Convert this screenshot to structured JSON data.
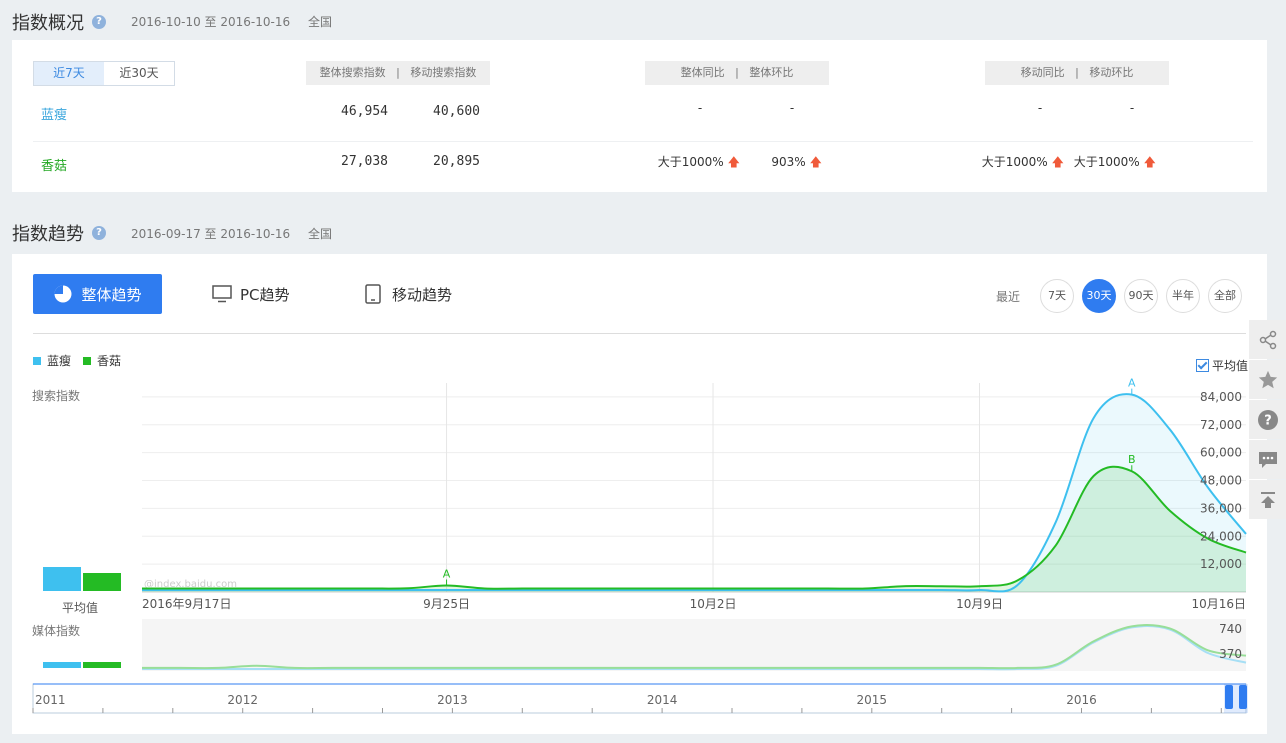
{
  "overview": {
    "title": "指数概况",
    "date_range": "2016-10-10 至 2016-10-16",
    "region": "全国",
    "tabs": [
      "近7天",
      "近30天"
    ],
    "header_total": "整体搜索指数",
    "header_mobile": "移动搜索指数",
    "header_yoy": "整体同比",
    "header_mom": "整体环比",
    "header_m_yoy": "移动同比",
    "header_m_mom": "移动环比",
    "sep": "|",
    "rows": [
      {
        "keyword": "蓝瘦",
        "total": "46,954",
        "mobile": "40,600",
        "yoy": "-",
        "mom": "-",
        "m_yoy": "-",
        "m_mom": "-"
      },
      {
        "keyword": "香菇",
        "total": "27,038",
        "mobile": "20,895",
        "yoy": "大于1000%",
        "mom": "903%",
        "m_yoy": "大于1000%",
        "m_mom": "大于1000%"
      }
    ]
  },
  "trend": {
    "title": "指数趋势",
    "date_range": "2016-09-17 至 2016-10-16",
    "region": "全国",
    "btn_overall": "整体趋势",
    "btn_pc": "PC趋势",
    "btn_mobile": "移动趋势",
    "recent_label": "最近",
    "ranges": [
      "7天",
      "30天",
      "90天",
      "半年",
      "全部"
    ],
    "avg_label": "平均值",
    "search_label": "搜索指数",
    "media_label": "媒体指数",
    "avg_bar_label": "平均值",
    "watermark": "@index.baidu.com",
    "marker_a": "A",
    "marker_b": "B"
  },
  "colors": {
    "lanshou": "#3ec0ef",
    "xianggu": "#24bb24",
    "accent": "#2f7cf0"
  },
  "chart_data": {
    "type": "area",
    "x": [
      "2016-09-17",
      "2016-09-18",
      "2016-09-19",
      "2016-09-20",
      "2016-09-21",
      "2016-09-22",
      "2016-09-23",
      "2016-09-24",
      "2016-09-25",
      "2016-09-26",
      "2016-09-27",
      "2016-09-28",
      "2016-09-29",
      "2016-09-30",
      "2016-10-01",
      "2016-10-02",
      "2016-10-03",
      "2016-10-04",
      "2016-10-05",
      "2016-10-06",
      "2016-10-07",
      "2016-10-08",
      "2016-10-09",
      "2016-10-10",
      "2016-10-11",
      "2016-10-12",
      "2016-10-13",
      "2016-10-14",
      "2016-10-15",
      "2016-10-16"
    ],
    "xticks": [
      "2016年9月17日",
      "9月25日",
      "10月2日",
      "10月9日",
      "10月16日"
    ],
    "series": [
      {
        "name": "蓝瘦",
        "values": [
          0,
          0,
          0,
          0,
          0,
          0,
          0,
          0,
          0,
          0,
          0,
          0,
          0,
          0,
          0,
          0,
          0,
          0,
          0,
          0,
          0,
          0,
          0,
          3000,
          30000,
          75000,
          85000,
          70000,
          45000,
          25000
        ]
      },
      {
        "name": "香菇",
        "values": [
          1500,
          1500,
          1500,
          1500,
          1500,
          1500,
          1500,
          1600,
          2800,
          1500,
          1500,
          1500,
          1500,
          1500,
          1500,
          1500,
          1500,
          1500,
          1500,
          1500,
          2500,
          2500,
          2500,
          5000,
          20000,
          50000,
          52000,
          35000,
          23000,
          17000
        ]
      }
    ],
    "ylim": [
      0,
      90000
    ],
    "yticks": [
      "12,000",
      "24,000",
      "36,000",
      "48,000",
      "60,000",
      "72,000",
      "84,000"
    ],
    "media": {
      "yticks": [
        "370",
        "740"
      ],
      "series": [
        {
          "name": "蓝瘦",
          "values": [
            0,
            0,
            0,
            0,
            0,
            0,
            0,
            0,
            0,
            0,
            0,
            0,
            0,
            0,
            0,
            0,
            0,
            0,
            0,
            0,
            0,
            0,
            0,
            0,
            60,
            500,
            780,
            740,
            300,
            120
          ]
        },
        {
          "name": "香菇",
          "values": [
            20,
            20,
            20,
            60,
            20,
            20,
            20,
            20,
            20,
            20,
            20,
            20,
            20,
            20,
            20,
            20,
            20,
            20,
            20,
            20,
            20,
            20,
            20,
            20,
            80,
            520,
            800,
            760,
            350,
            250
          ]
        }
      ]
    },
    "navigator": {
      "labels": [
        "2011",
        "2012",
        "2013",
        "2014",
        "2015",
        "2016"
      ]
    }
  }
}
